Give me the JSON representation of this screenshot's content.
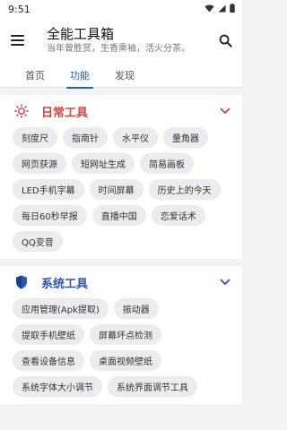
{
  "status": {
    "time": "9:51"
  },
  "appbar": {
    "title": "全能工具箱",
    "subtitle": "当年曾胜赏，生香熏袖，活火分茶。"
  },
  "tabs": [
    {
      "label": "首页"
    },
    {
      "label": "功能"
    },
    {
      "label": "发现"
    }
  ],
  "sections": [
    {
      "title": "日常工具",
      "color": "#d9423a",
      "icon": "sun-icon",
      "items": [
        "刻度尺",
        "指南针",
        "水平仪",
        "量角器",
        "网页获源",
        "短网址生成",
        "简易画板",
        "LED手机字幕",
        "时间屏幕",
        "历史上的今天",
        "每日60秒早报",
        "直播中国",
        "恋爱话术",
        "QQ变音"
      ]
    },
    {
      "title": "系统工具",
      "color": "#2a55b3",
      "icon": "shield-icon",
      "items": [
        "应用管理(Apk提取)",
        "振动器",
        "提取手机壁纸",
        "屏幕坏点检测",
        "查看设备信息",
        "桌面视频壁纸",
        "系统字体大小调节",
        "系统界面调节工具"
      ]
    }
  ],
  "colors": {
    "accent": "#1f5fbf"
  }
}
